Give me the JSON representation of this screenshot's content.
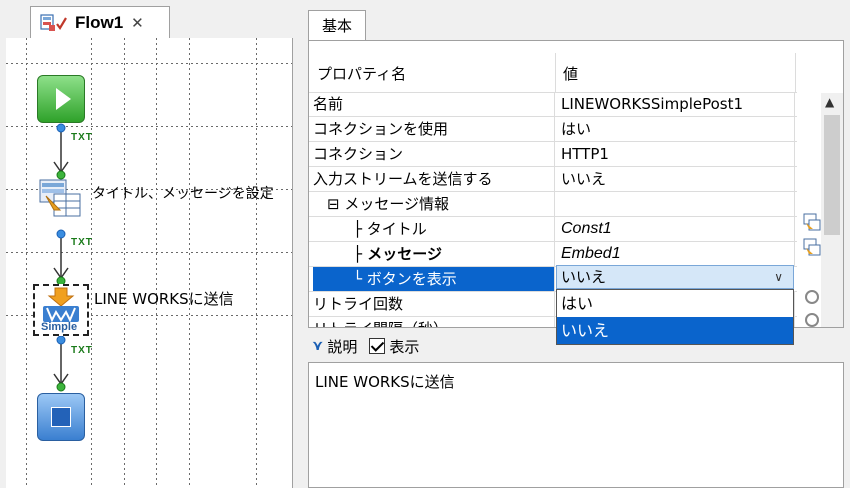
{
  "flow": {
    "tab_title": "Flow1",
    "tab_close": "✕",
    "nodes": [
      {
        "name": "start",
        "label": ""
      },
      {
        "name": "set-title-message",
        "label": "タイトル、メッセージを設定"
      },
      {
        "name": "lineworks-send",
        "label": "LINE WORKSに送信",
        "badge": "Simple"
      },
      {
        "name": "end",
        "label": ""
      }
    ],
    "connector_label": "TXT"
  },
  "properties": {
    "tab_label": "基本",
    "header": {
      "name_col": "プロパティ名",
      "value_col": "値"
    },
    "rows": [
      {
        "name": "名前",
        "value": "LINEWORKSSimplePost1"
      },
      {
        "name": "コネクションを使用",
        "value": "はい"
      },
      {
        "name": "コネクション",
        "value": "HTTP1"
      },
      {
        "name": "入力ストリームを送信する",
        "value": "いいえ"
      },
      {
        "name": "⊟ メッセージ情報",
        "value": ""
      },
      {
        "name": "├ タイトル",
        "value": "Const1"
      },
      {
        "name": "├ メッセージ",
        "value": "Embed1"
      },
      {
        "name": "└ ボタンを表示",
        "value": "いいえ"
      },
      {
        "name": "リトライ回数",
        "value": ""
      },
      {
        "name": "リトライ間隔（秒）",
        "value": ""
      }
    ],
    "dropdown": {
      "current": "いいえ",
      "options": [
        "はい",
        "いいえ"
      ],
      "selected_index": 1
    }
  },
  "description": {
    "label": "説明",
    "checkbox_label": "表示",
    "text": "LINE WORKSに送信"
  },
  "colors": {
    "selection": "#0a64cc",
    "start_green": "#2fa22a",
    "end_blue": "#3a7fd0",
    "connector_green": "#1a7a1a"
  }
}
